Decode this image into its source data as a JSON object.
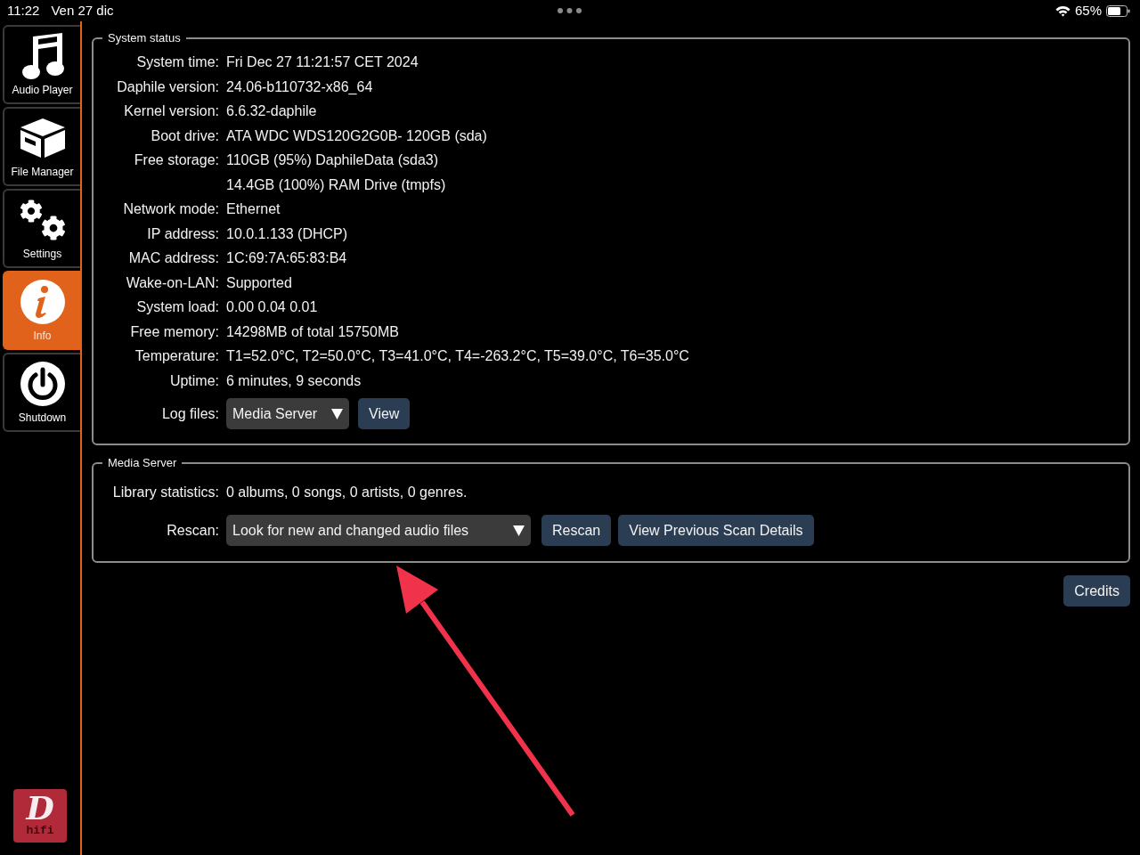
{
  "status_bar": {
    "time": "11:22",
    "date": "Ven 27 dic",
    "battery": "65%"
  },
  "sidebar": {
    "items": [
      {
        "label": "Audio Player",
        "selected": false
      },
      {
        "label": "File Manager",
        "selected": false
      },
      {
        "label": "Settings",
        "selected": false
      },
      {
        "label": "Info",
        "selected": true
      },
      {
        "label": "Shutdown",
        "selected": false
      }
    ],
    "logo": {
      "letter": "D",
      "caption": "hifi"
    }
  },
  "system_status": {
    "legend": "System status",
    "rows": [
      {
        "label": "System time:",
        "value": "Fri Dec 27 11:21:57 CET 2024"
      },
      {
        "label": "Daphile version:",
        "value": "24.06-b110732-x86_64"
      },
      {
        "label": "Kernel version:",
        "value": "6.6.32-daphile"
      },
      {
        "label": "Boot drive:",
        "value": "ATA WDC WDS120G2G0B- 120GB (sda)"
      },
      {
        "label": "Free storage:",
        "value": "110GB (95%) DaphileData (sda3)"
      },
      {
        "value": "14.4GB (100%) RAM Drive (tmpfs)"
      },
      {
        "label": "Network mode:",
        "value": "Ethernet"
      },
      {
        "label": "IP address:",
        "value": "10.0.1.133 (DHCP)"
      },
      {
        "label": "MAC address:",
        "value": "1C:69:7A:65:83:B4"
      },
      {
        "label": "Wake-on-LAN:",
        "value": "Supported"
      },
      {
        "label": "System load:",
        "value": "0.00 0.04 0.01"
      },
      {
        "label": "Free memory:",
        "value": "14298MB of total 15750MB"
      },
      {
        "label": "Temperature:",
        "value": "T1=52.0°C, T2=50.0°C, T3=41.0°C, T4=-263.2°C, T5=39.0°C, T6=35.0°C"
      },
      {
        "label": "Uptime:",
        "value": "6 minutes, 9 seconds"
      }
    ],
    "log_files": {
      "label": "Log files:",
      "value": "Media Server",
      "button": "View"
    }
  },
  "media_server": {
    "legend": "Media Server",
    "library": {
      "label": "Library statistics:",
      "value": "0 albums, 0 songs, 0 artists, 0 genres."
    },
    "rescan": {
      "label": "Rescan:",
      "value": "Look for new and changed audio files",
      "buttons": [
        "Rescan",
        "View Previous Scan Details"
      ]
    }
  },
  "credits_button": "Credits"
}
